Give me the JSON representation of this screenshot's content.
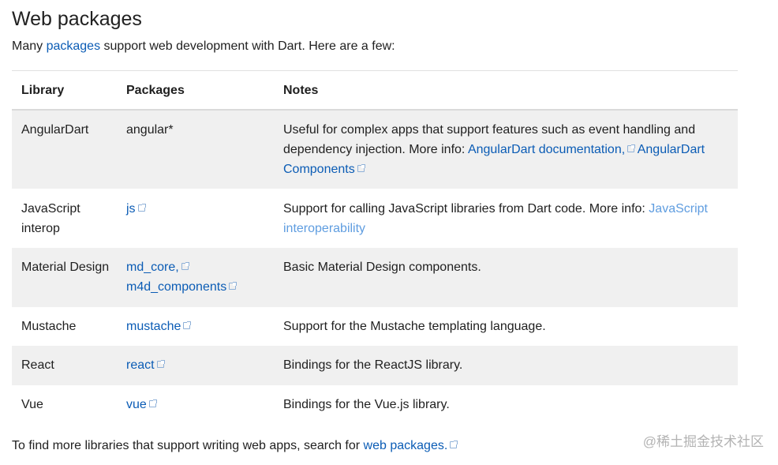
{
  "page": {
    "title": "Web packages",
    "intro": {
      "before": "Many ",
      "link": "packages",
      "after": " support web development with Dart. Here are a few:"
    }
  },
  "table": {
    "headers": {
      "library": "Library",
      "packages": "Packages",
      "notes": "Notes"
    },
    "rows": [
      {
        "library": "AngularDart",
        "packages_text": "angular*",
        "notes_text": "Useful for complex apps that support features such as event handling and dependency injection. More info: ",
        "notes_link1": "AngularDart documentation,",
        "notes_link2": "AngularDart Components"
      },
      {
        "library": "JavaScript interop",
        "package": "js",
        "notes_text": "Support for calling JavaScript libraries from Dart code. More info: ",
        "notes_link": "JavaScript interoperability"
      },
      {
        "library": "Material Design",
        "package1": "md_core,",
        "package2": "m4d_components",
        "notes": "Basic Material Design components."
      },
      {
        "library": "Mustache",
        "package": "mustache",
        "notes": "Support for the Mustache templating language."
      },
      {
        "library": "React",
        "package": "react",
        "notes": "Bindings for the ReactJS library."
      },
      {
        "library": "Vue",
        "package": "vue",
        "notes": "Bindings for the Vue.js library."
      }
    ]
  },
  "footer": {
    "text": "To find more libraries that support writing web apps, search for ",
    "link": "web packages."
  },
  "watermark": "@稀土掘金技术社区",
  "icons": {
    "external_link": "external-link-icon"
  },
  "colors": {
    "link": "#0b5cb5",
    "link_light": "#5f9de0",
    "row_shade": "#f0f0f0"
  }
}
